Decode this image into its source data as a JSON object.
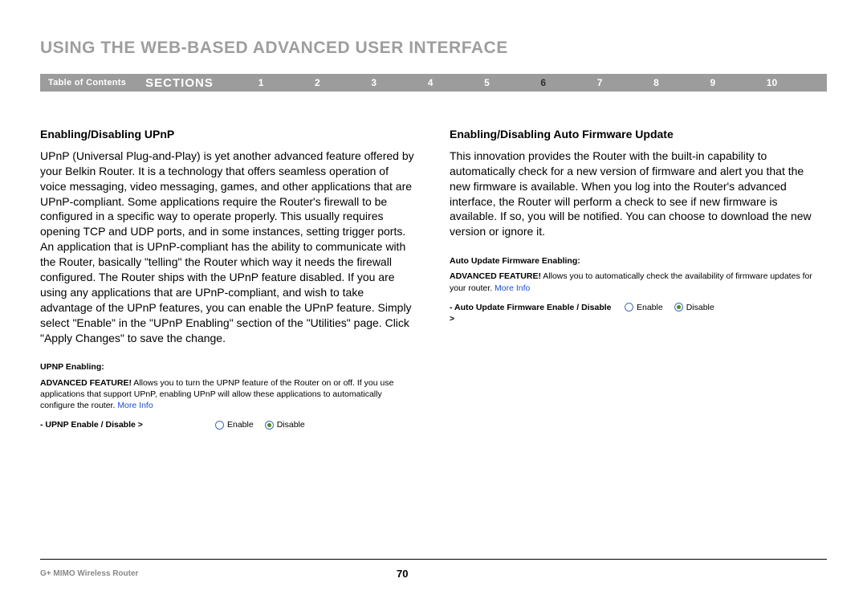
{
  "header": {
    "title": "USING THE WEB-BASED ADVANCED USER INTERFACE"
  },
  "nav": {
    "toc": "Table of Contents",
    "sections_label": "SECTIONS",
    "links": [
      "1",
      "2",
      "3",
      "4",
      "5",
      "6",
      "7",
      "8",
      "9",
      "10"
    ],
    "active_index": 5
  },
  "left": {
    "heading": "Enabling/Disabling UPnP",
    "body": "UPnP (Universal Plug-and-Play) is yet another advanced feature offered by your Belkin Router. It is a technology that offers seamless operation of voice messaging, video messaging, games, and other applications that are UPnP-compliant. Some applications require the Router's firewall to be configured in a specific way to operate properly. This usually requires opening TCP and UDP ports, and in some instances, setting trigger ports. An application that is UPnP-compliant has the ability to communicate with the Router, basically \"telling\" the Router which way it needs the firewall configured. The Router ships with the UPnP feature disabled. If you are using any applications that are UPnP-compliant, and wish to take advantage of the UPnP features, you can enable the UPnP feature. Simply select \"Enable\" in the \"UPnP Enabling\" section of the \"Utilities\" page. Click \"Apply Changes\" to save the change.",
    "ui": {
      "title": "UPNP Enabling:",
      "desc_bold": "ADVANCED FEATURE!",
      "desc": " Allows you to turn the UPNP feature of the Router on or off. If you use applications that support UPnP, enabling UPnP will allow these applications to automatically configure the router. ",
      "more_info": "More Info",
      "opt_label": "- UPNP Enable / Disable >",
      "enable": "Enable",
      "disable": "Disable",
      "selected": "disable"
    }
  },
  "right": {
    "heading": "Enabling/Disabling Auto Firmware Update",
    "body": "This innovation provides the Router with the built-in capability to automatically check for a new version of firmware and alert you that the new firmware is available. When you log into the Router's advanced interface, the Router will perform a check to see if new firmware is available. If so, you will be notified. You can choose to download the new version or ignore it.",
    "ui": {
      "title": "Auto Update Firmware Enabling:",
      "desc_bold": "ADVANCED FEATURE!",
      "desc": " Allows you to automatically check the availability of firmware updates for your router. ",
      "more_info": "More Info",
      "opt_label": "- Auto Update Firmware Enable / Disable >",
      "enable": "Enable",
      "disable": "Disable",
      "selected": "disable"
    }
  },
  "footer": {
    "product": "G+ MIMO Wireless Router",
    "page": "70"
  }
}
